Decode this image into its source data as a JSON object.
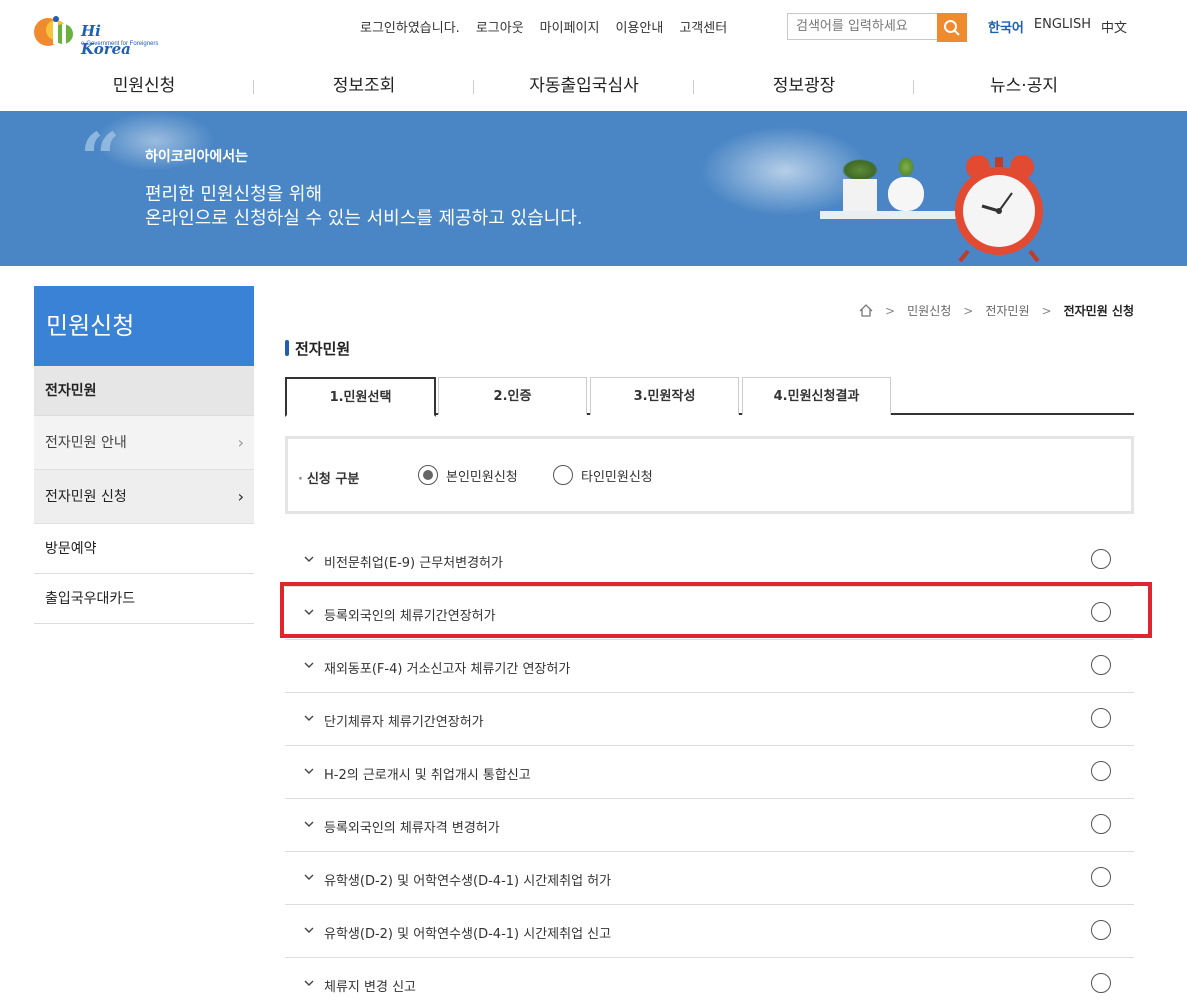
{
  "header": {
    "logo_brand": "Hi Korea",
    "logo_tagline": "e-Government for Foreigners",
    "status_text": "로그인하였습니다.",
    "util_links": [
      "로그아웃",
      "마이페이지",
      "이용안내",
      "고객센터"
    ],
    "search_placeholder": "검색어를 입력하세요",
    "languages": [
      "한국어",
      "ENGLISH",
      "中文"
    ],
    "active_language": "한국어"
  },
  "gnb": [
    "민원신청",
    "정보조회",
    "자동출입국심사",
    "정보광장",
    "뉴스·공지"
  ],
  "banner": {
    "intro": "하이코리아에서는",
    "line1": "편리한 민원신청을 위해",
    "line2": "온라인으로 신청하실 수 있는 서비스를 제공하고 있습니다."
  },
  "sidebar": {
    "title": "민원신청",
    "items": [
      {
        "label": "전자민원",
        "active": true
      },
      {
        "label": "전자민원 안내",
        "sub": true
      },
      {
        "label": "전자민원 신청",
        "sub": true,
        "current": true
      },
      {
        "label": "방문예약"
      },
      {
        "label": "출입국우대카드"
      }
    ]
  },
  "breadcrumb": [
    "민원신청",
    "전자민원",
    "전자민원 신청"
  ],
  "section_title": "전자민원",
  "tabs": [
    "1.민원선택",
    "2.인증",
    "3.민원작성",
    "4.민원신청결과"
  ],
  "active_tab": "1.민원선택",
  "application_type": {
    "label": "신청 구분",
    "options": [
      "본인민원신청",
      "타인민원신청"
    ],
    "selected": "본인민원신청"
  },
  "services": [
    "비전문취업(E-9) 근무처변경허가",
    "등록외국인의 체류기간연장허가",
    "재외동포(F-4) 거소신고자 체류기간 연장허가",
    "단기체류자 체류기간연장허가",
    "H-2의 근로개시 및 취업개시 통합신고",
    "등록외국인의 체류자격 변경허가",
    "유학생(D-2) 및 어학연수생(D-4-1) 시간제취업 허가",
    "유학생(D-2) 및 어학연수생(D-4-1) 시간제취업 신고",
    "체류지 변경 신고"
  ],
  "highlighted_service": "등록외국인의 체류기간연장허가",
  "colors": {
    "brand_blue": "#1e5fb3",
    "banner_blue": "#4a86c5",
    "sidebar_blue": "#3a82d6",
    "search_orange": "#f08a2e",
    "highlight_red": "#e0252f"
  },
  "icons": {
    "search": "search-icon",
    "home": "home-icon",
    "chevron_right": "chevron-right-icon",
    "chevron_down": "chevron-down-icon"
  }
}
